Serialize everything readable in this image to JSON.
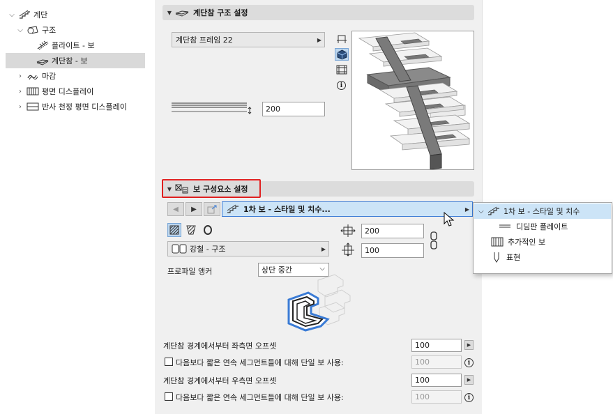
{
  "tree": {
    "root": "계단",
    "structure": "구조",
    "flight_beam": "플라이트 - 보",
    "landing_beam": "계단참 - 보",
    "finish": "마감",
    "floor_plan_display": "평면 디스플레이",
    "reflected_ceiling_display": "반사 천정 평면 디스플레이"
  },
  "landing_structure": {
    "header": "계단참 구조 설정",
    "frame_popup": "계단참 프레임 22",
    "thickness_value": "200"
  },
  "beam_components": {
    "header": "보 구성요소 설정",
    "component_popup": "1차 보 - 스타일 및 치수...",
    "width_value": "200",
    "height_value": "100",
    "material_popup": "강철 - 구조",
    "anchor_label": "프로파일 앵커",
    "anchor_value": "상단 중간",
    "left_offset_label": "계단참 경계에서부터 좌측면 오프셋",
    "left_offset_value": "100",
    "single_beam_left_label": "다음보다 짧은 연속 세그먼트들에 대해 단일 보 사용:",
    "single_beam_left_value": "100",
    "right_offset_label": "계단참 경계에서부터 우측면 오프셋",
    "right_offset_value": "100",
    "single_beam_right_label": "다음보다 짧은 연속 세그먼트들에 대해 단일 보 사용:",
    "single_beam_right_value": "100"
  },
  "dropdown": {
    "items": [
      {
        "label": "1차 보 - 스타일 및 치수"
      },
      {
        "label": "디딤판 플레이트"
      },
      {
        "label": "추가적인 보"
      },
      {
        "label": "표현"
      }
    ]
  },
  "colors": {
    "highlight_red": "#e02020",
    "selection_blue": "#cce4f7",
    "accent_blue": "#3a7bd5"
  }
}
